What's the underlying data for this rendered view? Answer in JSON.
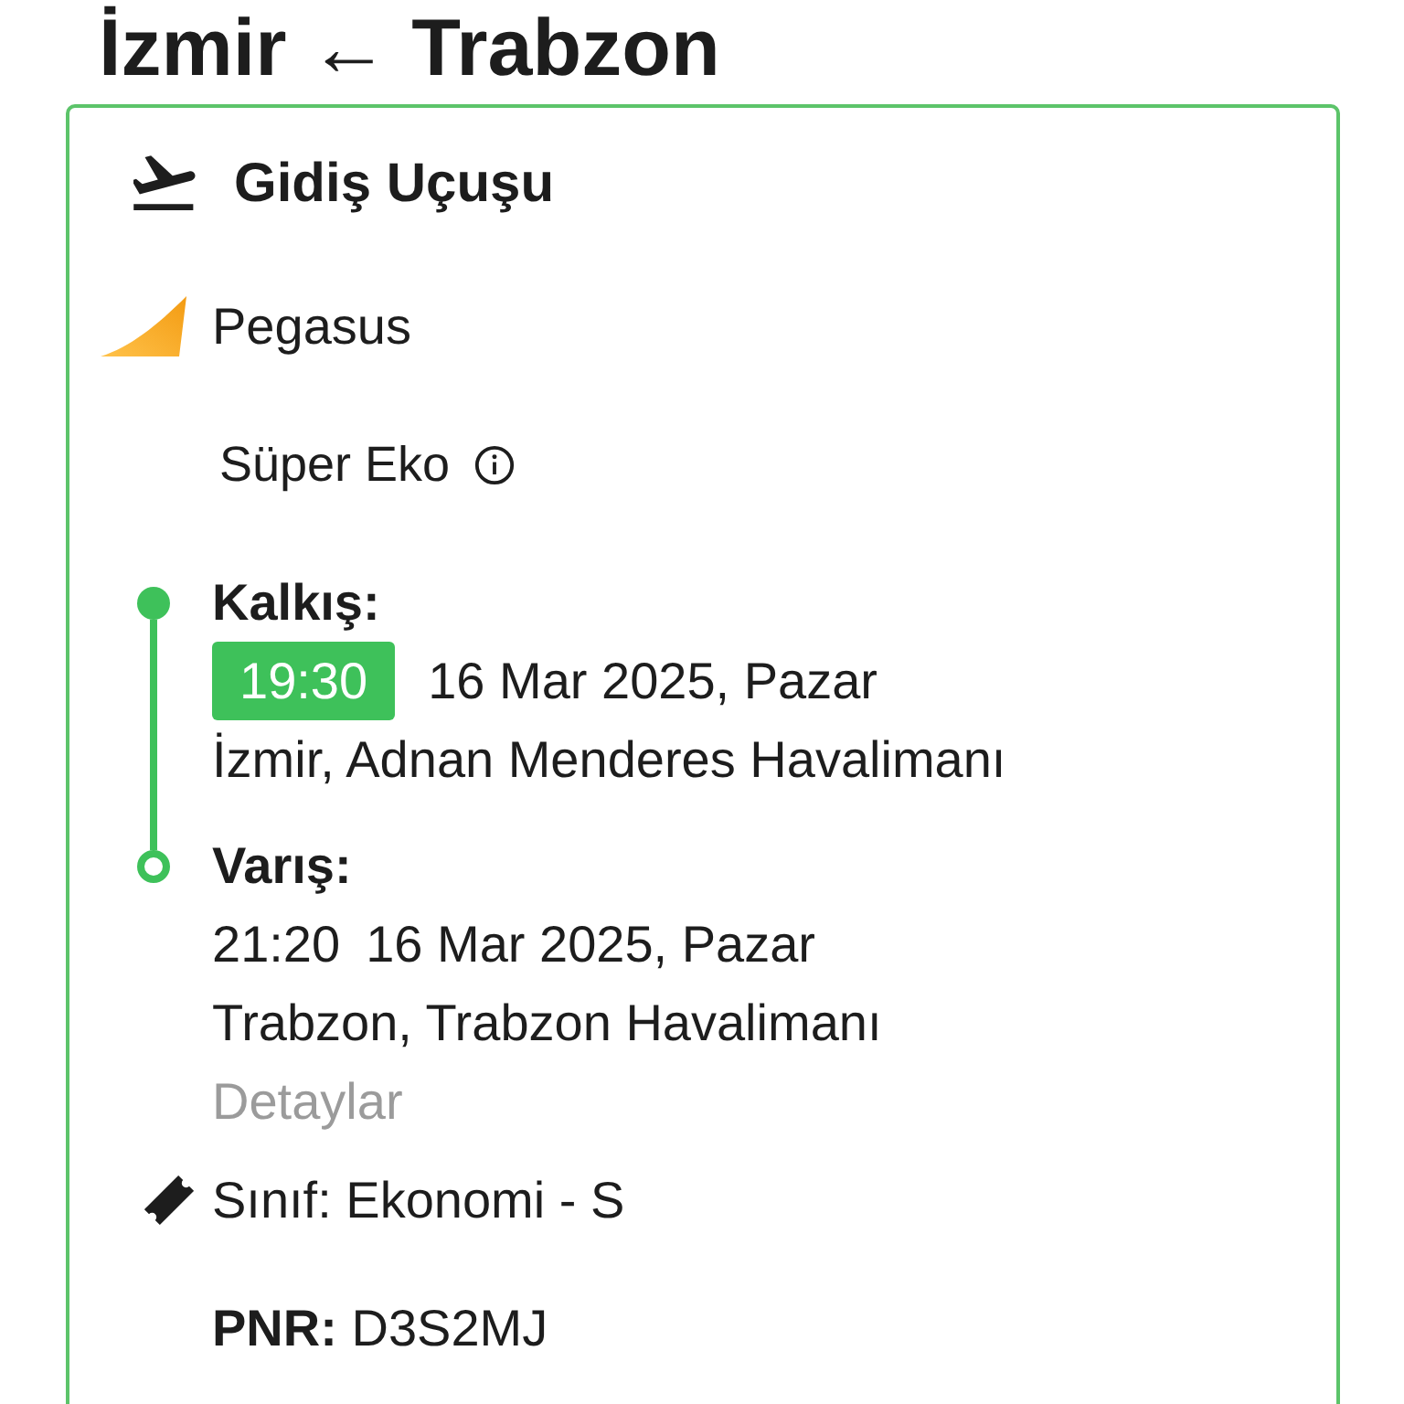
{
  "route_title": "İzmir ← Trabzon",
  "flight_card": {
    "heading": "Gidiş Uçuşu",
    "airline": "Pegasus",
    "fare_type": "Süper Eko",
    "stops": [
      {
        "kind": "departure",
        "label": "Kalkış:",
        "time": "19:30",
        "date": "16 Mar 2025, Pazar",
        "airport": "İzmir, Adnan Menderes Havalimanı"
      },
      {
        "kind": "arrival",
        "label": "Varış:",
        "time": "21:20",
        "date": "16 Mar 2025, Pazar",
        "airport": "Trabzon, Trabzon Havalimanı",
        "details_link": "Detaylar"
      }
    ],
    "cabin_class": "Sınıf: Ekonomi - S",
    "pnr": "**PNR:** D3S2MJ"
  }
}
